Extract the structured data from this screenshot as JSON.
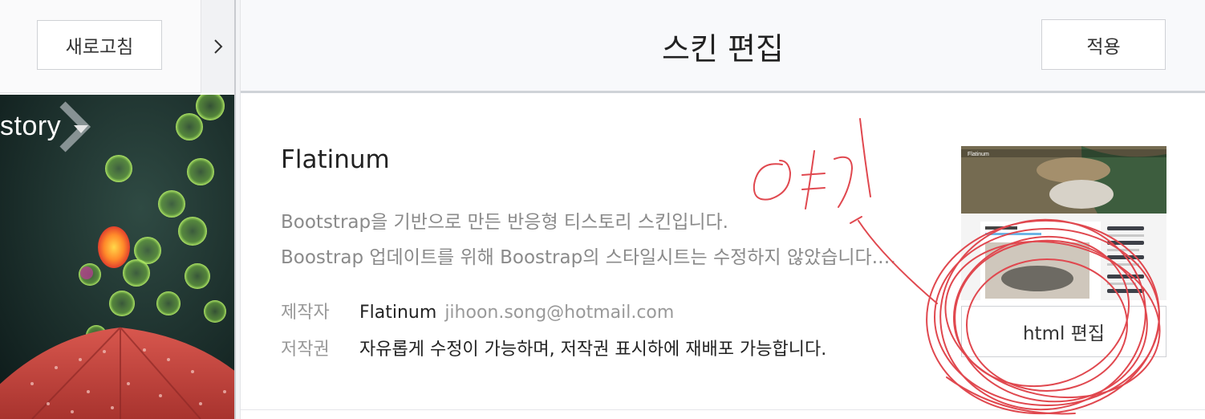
{
  "left_panel": {
    "refresh_label": "새로고침",
    "preview_logo_text": "story"
  },
  "header": {
    "title": "스킨 편집",
    "apply_label": "적용"
  },
  "skin": {
    "name": "Flatinum",
    "description_lines": [
      "Bootstrap을 기반으로 만든 반응형 티스토리 스킨입니다.",
      "Boostrap 업데이트를 위해 Boostrap의 스타일시트는 수정하지 않았습니다.…"
    ],
    "author_label": "제작자",
    "author_name": "Flatinum",
    "author_email": "jihoon.song@hotmail.com",
    "copyright_label": "저작권",
    "copyright_text": "자유롭게 수정이 가능하며, 저작권 표시하에 재배포 가능합니다.",
    "edit_html_label": "html 편집"
  },
  "annotation": {
    "handwritten_text": "여기",
    "color": "#e0484f"
  },
  "colors": {
    "header_bg": "#f8f9fb",
    "border": "#cfd1d5",
    "muted_text": "#8a8a8a"
  }
}
